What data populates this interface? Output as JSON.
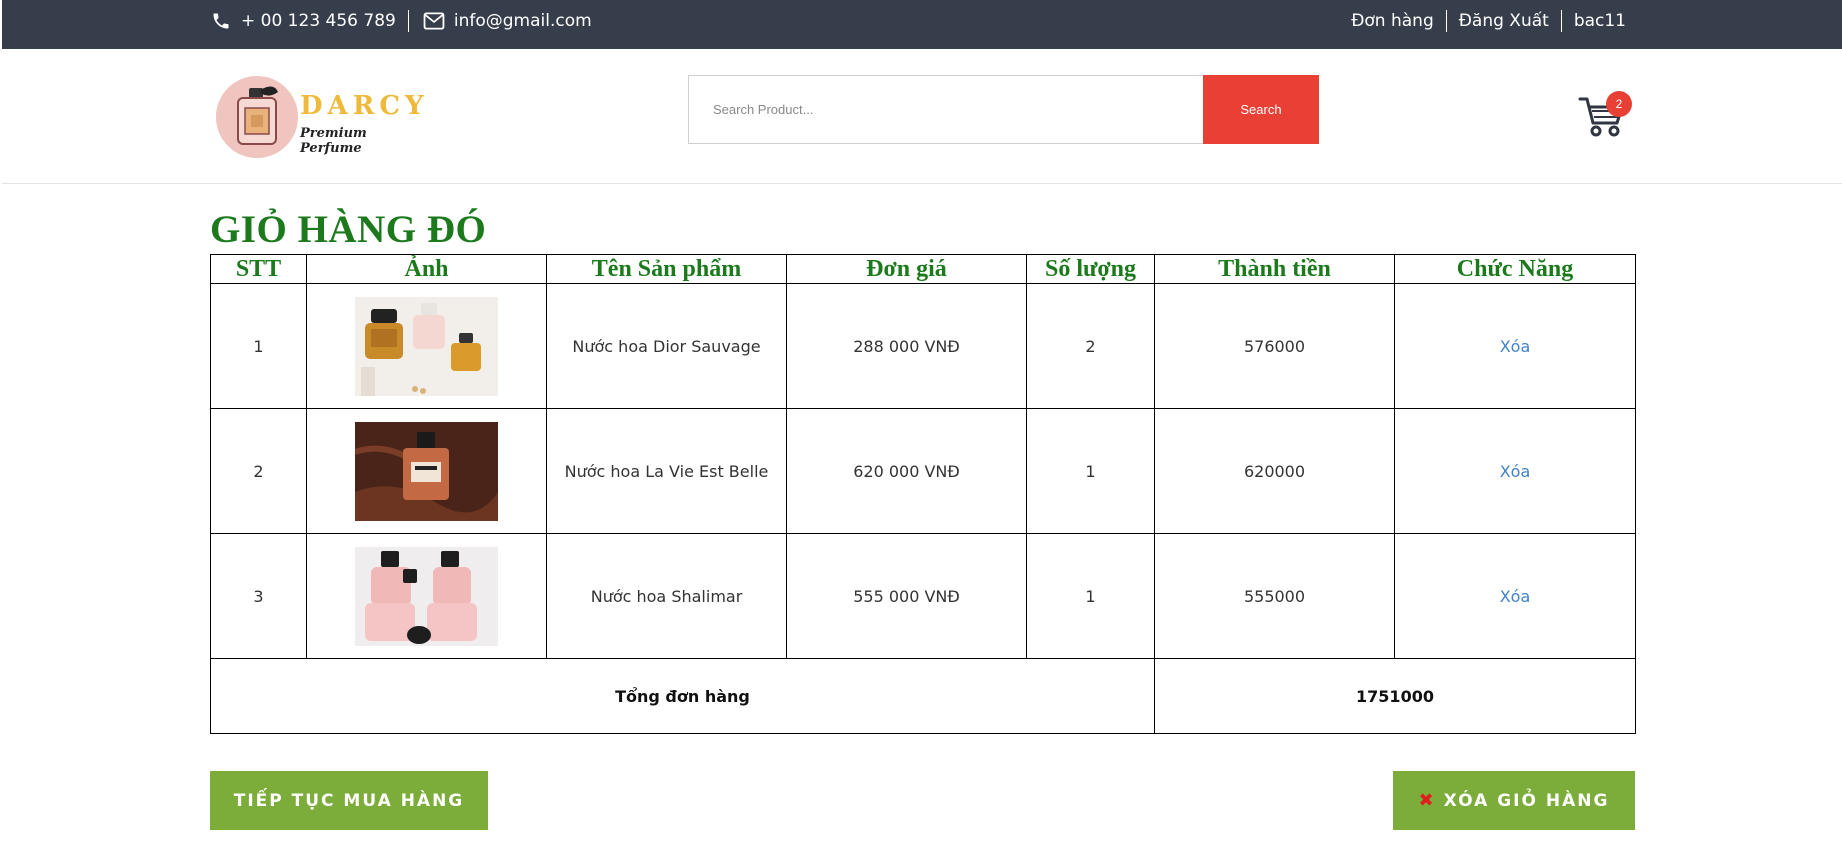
{
  "topbar": {
    "phone": "+ 00 123 456 789",
    "email": "info@gmail.com",
    "links": [
      "Đơn hàng",
      "Đăng Xuất",
      "bac11"
    ]
  },
  "header": {
    "brand": "DARCY",
    "tagline": "Premium Perfume",
    "search": {
      "placeholder": "Search Product...",
      "button": "Search"
    },
    "cart_count": "2"
  },
  "main": {
    "title": "GIỎ HÀNG ĐÓ",
    "columns": [
      "STT",
      "Ảnh",
      "Tên Sản phẩm",
      "Đơn giá",
      "Số lượng",
      "Thành tiền",
      "Chức Năng"
    ],
    "rows": [
      {
        "stt": "1",
        "name": "Nước hoa Dior Sauvage",
        "price": "288 000 VNĐ",
        "qty": "2",
        "subtotal": "576000",
        "action": "Xóa"
      },
      {
        "stt": "2",
        "name": "Nước hoa La Vie Est Belle",
        "price": "620 000 VNĐ",
        "qty": "1",
        "subtotal": "620000",
        "action": "Xóa"
      },
      {
        "stt": "3",
        "name": "Nước hoa Shalimar",
        "price": "555 000 VNĐ",
        "qty": "1",
        "subtotal": "555000",
        "action": "Xóa"
      }
    ],
    "total_label": "Tổng đơn hàng",
    "total_value": "1751000"
  },
  "actions": {
    "continue": "TIẾP TỤC MUA HÀNG",
    "clear": "XÓA GIỎ HÀNG"
  },
  "colors": {
    "topbar_bg": "#363e4c",
    "search_button": "#e94036",
    "title_green": "#1c7a1c",
    "action_button": "#7cad3a",
    "link_blue": "#3f82c8"
  },
  "icons": [
    "phone-icon",
    "envelope-icon",
    "cart-icon"
  ]
}
